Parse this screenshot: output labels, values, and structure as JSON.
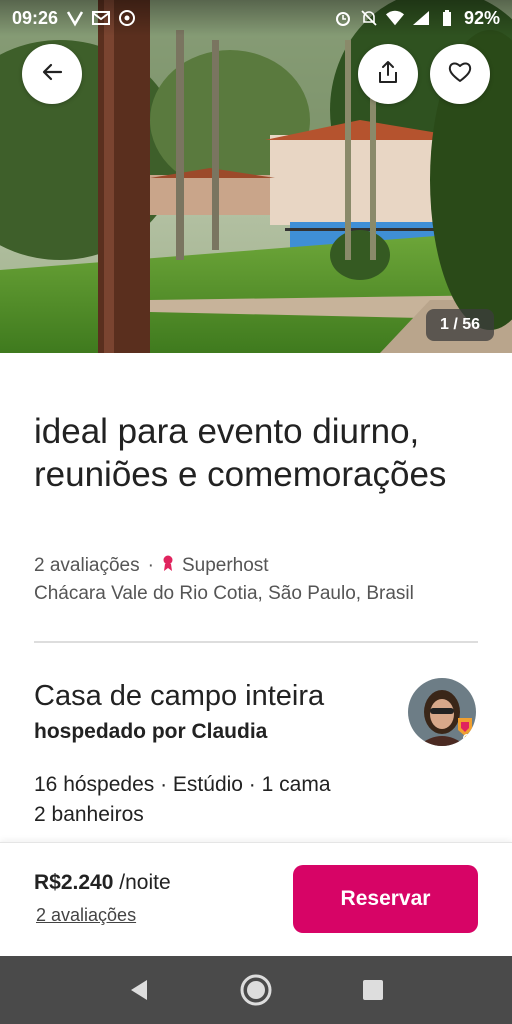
{
  "status_bar": {
    "time": "09:26",
    "battery": "92%",
    "left_icons": [
      "v-notification-icon",
      "gmail-icon",
      "whatsapp-icon"
    ],
    "right_icons": [
      "alarm-icon",
      "mute-icon",
      "wifi-icon",
      "signal-icon",
      "battery-icon"
    ]
  },
  "gallery": {
    "counter": "1 / 56"
  },
  "listing": {
    "title": "ideal para evento diurno, reuniões e comemorações",
    "reviews": "2 avaliações",
    "separator": "·",
    "superhost": "Superhost",
    "location": "Chácara Vale do Rio Cotia, São Paulo, Brasil"
  },
  "summary": {
    "type": "Casa de campo inteira",
    "host": "hospedado por Claudia",
    "details_line1": "16 hóspedes · Estúdio · 1 cama",
    "details_line2": "2 banheiros"
  },
  "booking": {
    "price": "R$2.240",
    "per_night": "/noite",
    "reviews_link": "2 avaliações",
    "reserve_label": "Reservar"
  },
  "colors": {
    "accent": "#D70466",
    "navbar": "#4A4A4A"
  }
}
